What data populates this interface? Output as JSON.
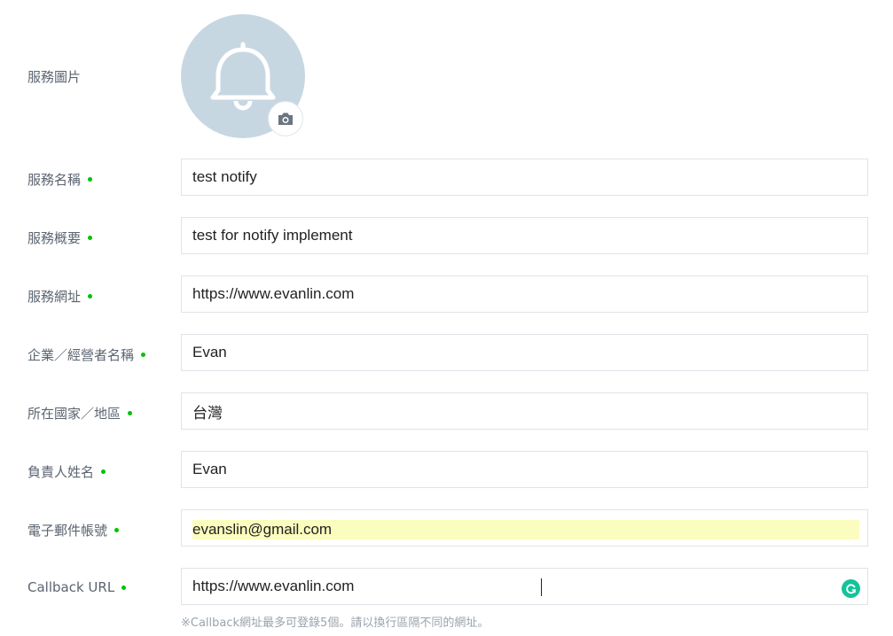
{
  "service_image": {
    "label": "服務圖片"
  },
  "fields": [
    {
      "label": "服務名稱",
      "value": "test notify"
    },
    {
      "label": "服務概要",
      "value": "test for notify implement"
    },
    {
      "label": "服務網址",
      "value": "https://www.evanlin.com"
    },
    {
      "label": "企業／經營者名稱",
      "value": "Evan"
    },
    {
      "label": "所在國家／地區",
      "value": "台灣"
    },
    {
      "label": "負責人姓名",
      "value": "Evan"
    },
    {
      "label": "電子郵件帳號",
      "value": "evanslin@gmail.com"
    },
    {
      "label": "Callback URL",
      "value": "https://www.evanlin.com"
    }
  ],
  "callback_hint": "※Callback網址最多可登錄5個。請以換行區隔不同的網址。",
  "colors": {
    "required_dot": "#00c300",
    "avatar_bg": "#c7d7e2",
    "autofill_bg": "#fafdbe",
    "grammarly": "#15c39a"
  },
  "icons": {
    "avatar": "bell-icon",
    "avatar_edit": "camera-icon",
    "grammar": "grammarly-icon"
  }
}
